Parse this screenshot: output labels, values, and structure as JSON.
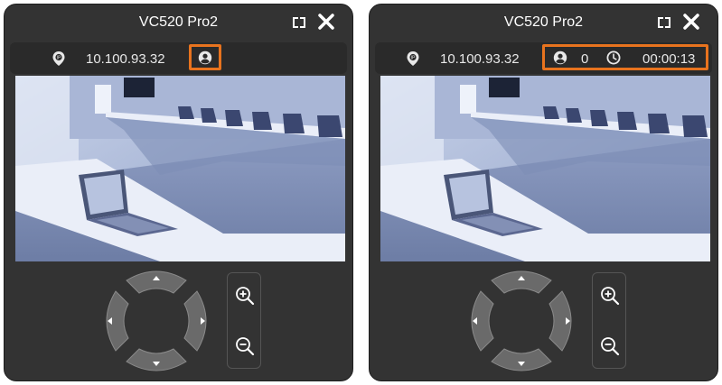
{
  "panels": [
    {
      "title": "VC520 Pro2",
      "ip": "10.100.93.32",
      "stats": null
    },
    {
      "title": "VC520 Pro2",
      "ip": "10.100.93.32",
      "stats": {
        "viewers": "0",
        "elapsed": "00:00:13"
      }
    }
  ],
  "icons": {
    "location": "ip-location-icon",
    "user": "user-icon",
    "clock": "clock-icon",
    "fullscreen": "fullscreen-icon",
    "close": "close-icon",
    "zoom_in": "zoom-in-icon",
    "zoom_out": "zoom-out-icon"
  },
  "colors": {
    "panel_bg": "#333333",
    "highlight": "#e8731e",
    "text": "#ffffff"
  }
}
